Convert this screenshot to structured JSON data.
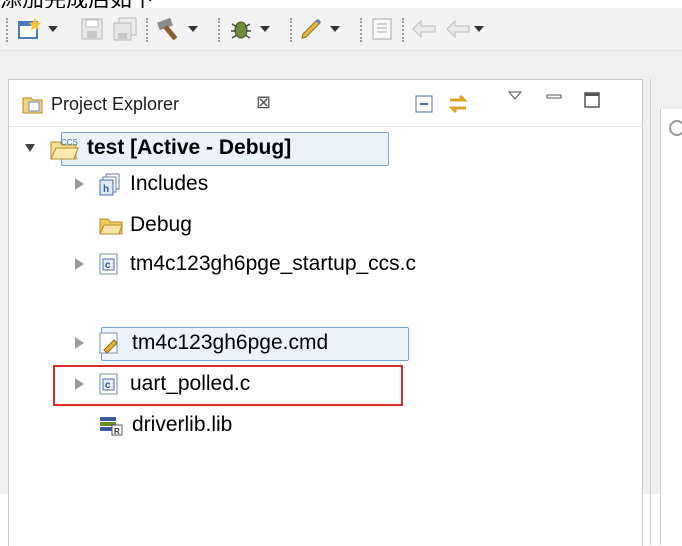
{
  "caption": "添加完成后如下",
  "toolbar": {
    "icons": [
      "new-wizard-icon",
      "save-icon",
      "save-all-icon",
      "build-icon",
      "debug-icon",
      "pen-icon",
      "console-icon",
      "back-icon",
      "forward-icon"
    ]
  },
  "view": {
    "title": "Project Explorer",
    "close_symbol": "⊠",
    "tab_icons": [
      "collapse-all-icon",
      "link-with-editor-icon",
      "view-menu-icon",
      "minimize-icon",
      "maximize-icon"
    ]
  },
  "tree": {
    "project": {
      "label": "test  [Active - Debug]",
      "expanded": true,
      "badge": "CCS"
    },
    "items": [
      {
        "label": "Includes",
        "twisty": "closed",
        "icon": "includes-icon"
      },
      {
        "label": "Debug",
        "twisty": "none",
        "icon": "folder-icon"
      },
      {
        "label": "tm4c123gh6pge_startup_ccs.c",
        "twisty": "closed",
        "icon": "c-file-icon"
      },
      {
        "label": "tm4c123gh6pge.cmd",
        "twisty": "closed",
        "icon": "cmd-file-icon"
      },
      {
        "label": "uart_polled.c",
        "twisty": "closed",
        "icon": "c-file-icon"
      },
      {
        "label": "driverlib.lib",
        "twisty": "none",
        "icon": "library-icon"
      }
    ]
  },
  "colors": {
    "selection_border": "#7da2ce",
    "highlight_box": "#e02a2a",
    "toolbar_bg": "#f3f3f3"
  }
}
